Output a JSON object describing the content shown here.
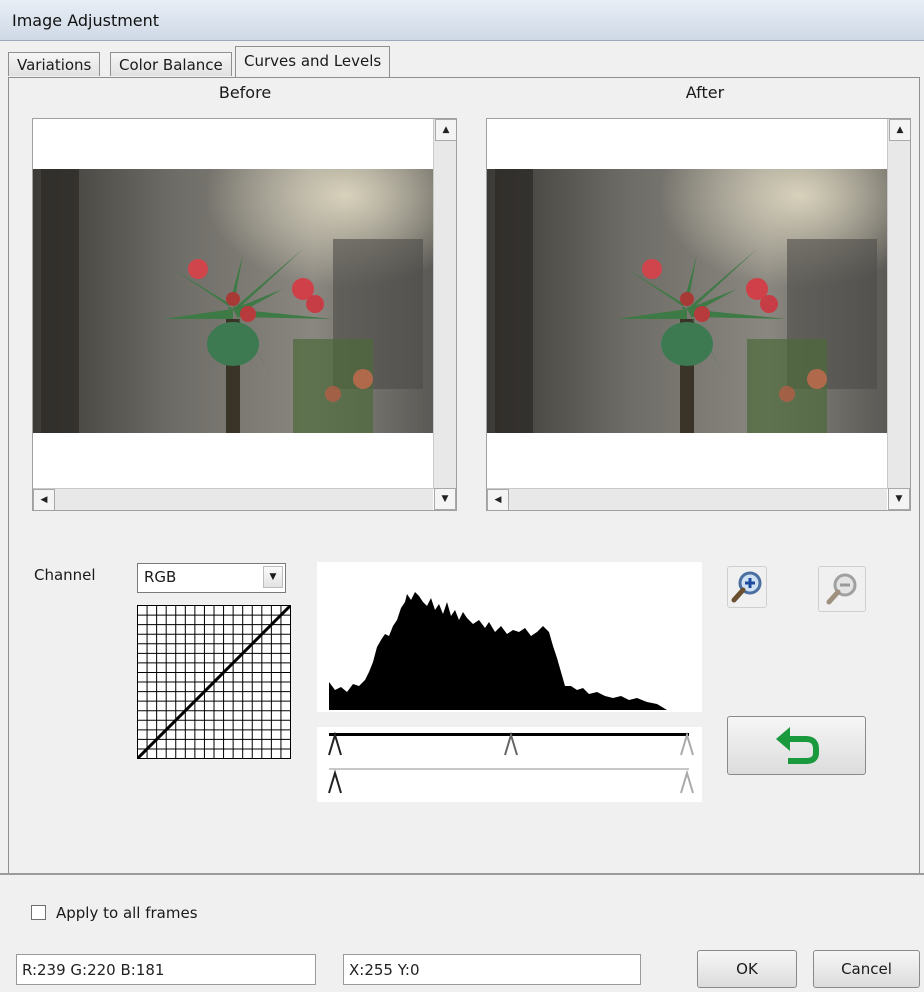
{
  "window": {
    "title": "Image Adjustment"
  },
  "tabs": [
    {
      "label": "Variations"
    },
    {
      "label": "Color Balance"
    },
    {
      "label": "Curves and Levels"
    }
  ],
  "preview": {
    "before_label": "Before",
    "after_label": "After"
  },
  "channel": {
    "label": "Channel",
    "selected": "RGB"
  },
  "curve": {
    "points": [
      [
        0,
        0
      ],
      [
        255,
        255
      ]
    ]
  },
  "levels": {
    "input": {
      "black": 0,
      "gamma_marker_position": 0.5,
      "white": 255
    },
    "output": {
      "black": 0,
      "white": 255
    }
  },
  "icons": {
    "zoom_in": "zoom-in-icon",
    "zoom_out": "zoom-out-icon",
    "reset": "undo-arrow-icon",
    "reset_color": "#1a9a3c"
  },
  "apply_all": {
    "label": "Apply to all frames",
    "checked": false
  },
  "status": {
    "rgb": "R:239 G:220 B:181",
    "xy": "X:255 Y:0"
  },
  "buttons": {
    "ok": "OK",
    "cancel": "Cancel"
  }
}
